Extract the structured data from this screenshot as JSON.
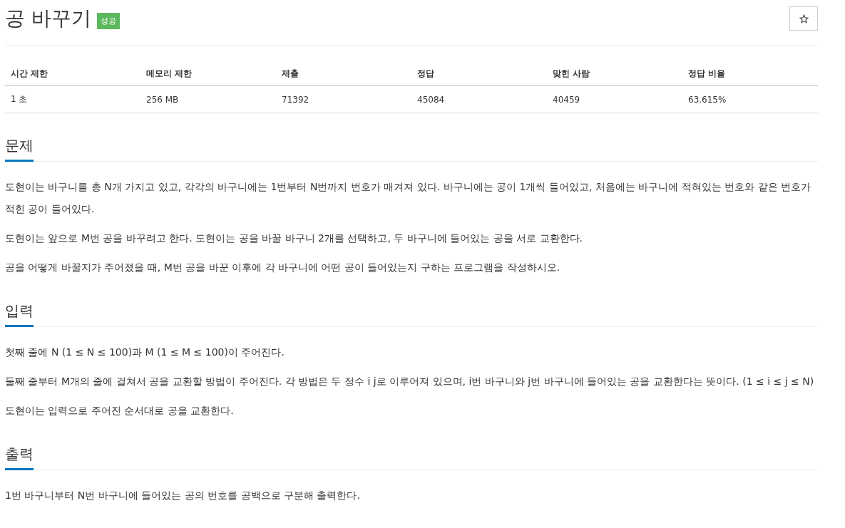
{
  "title": "공 바꾸기",
  "badge": "성공",
  "stats": {
    "columns": [
      "시간 제한",
      "메모리 제한",
      "제출",
      "정답",
      "맞힌 사람",
      "정답 비율"
    ],
    "values": [
      "1 초",
      "256 MB",
      "71392",
      "45084",
      "40459",
      "63.615%"
    ]
  },
  "sections": [
    {
      "heading": "문제",
      "paragraphs": [
        "도현이는 바구니를 총 N개 가지고 있고, 각각의 바구니에는 1번부터 N번까지 번호가 매겨져 있다. 바구니에는 공이 1개씩 들어있고, 처음에는 바구니에 적혀있는 번호와 같은 번호가 적힌 공이 들어있다.",
        "도현이는 앞으로 M번 공을 바꾸려고 한다. 도현이는 공을 바꿀 바구니 2개를 선택하고, 두 바구니에 들어있는 공을 서로 교환한다.",
        "공을 어떻게 바꿀지가 주어졌을 때, M번 공을 바꾼 이후에 각 바구니에 어떤 공이 들어있는지 구하는 프로그램을 작성하시오."
      ]
    },
    {
      "heading": "입력",
      "paragraphs": [
        "첫째 줄에 N (1 ≤ N ≤ 100)과 M (1 ≤ M ≤ 100)이 주어진다.",
        "둘째 줄부터 M개의 줄에 걸쳐서 공을 교환할 방법이 주어진다. 각 방법은 두 정수 i j로 이루어져 있으며, i번 바구니와 j번 바구니에 들어있는 공을 교환한다는 뜻이다. (1 ≤ i ≤ j ≤ N)",
        "도현이는 입력으로 주어진 순서대로 공을 교환한다."
      ]
    },
    {
      "heading": "출력",
      "paragraphs": [
        "1번 바구니부터 N번 바구니에 들어있는 공의 번호를 공백으로 구분해 출력한다."
      ]
    }
  ]
}
